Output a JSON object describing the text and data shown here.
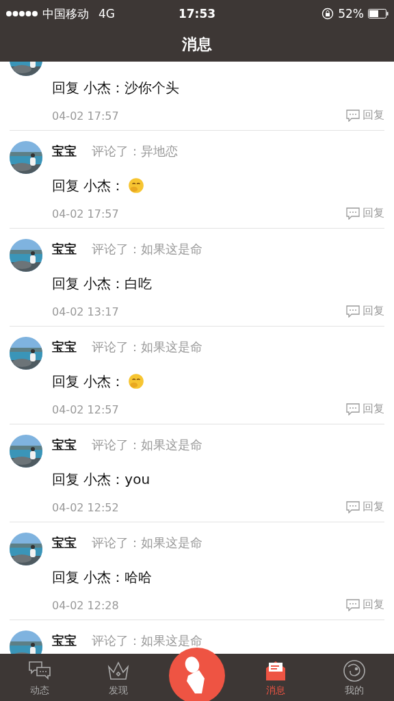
{
  "status_bar": {
    "carrier": "中国移动",
    "network": "4G",
    "time": "17:53",
    "battery": "52%"
  },
  "nav": {
    "title": "消息"
  },
  "messages": [
    {
      "reply": "回复 小杰：沙你个头",
      "sticker": false,
      "time": "04-02 17:57",
      "reply_button": "回复"
    },
    {
      "author": "宝宝",
      "action": "评论了：异地恋",
      "reply": "回复 小杰：",
      "sticker": true,
      "time": "04-02 17:57",
      "reply_button": "回复"
    },
    {
      "author": "宝宝",
      "action": "评论了：如果这是命",
      "reply": "回复 小杰：白吃",
      "sticker": false,
      "time": "04-02 13:17",
      "reply_button": "回复"
    },
    {
      "author": "宝宝",
      "action": "评论了：如果这是命",
      "reply": "回复 小杰：",
      "sticker": true,
      "time": "04-02 12:57",
      "reply_button": "回复"
    },
    {
      "author": "宝宝",
      "action": "评论了：如果这是命",
      "reply": "回复 小杰：you",
      "sticker": false,
      "time": "04-02 12:52",
      "reply_button": "回复"
    },
    {
      "author": "宝宝",
      "action": "评论了：如果这是命",
      "reply": "回复 小杰：哈哈",
      "sticker": false,
      "time": "04-02 12:28",
      "reply_button": "回复"
    },
    {
      "author": "宝宝",
      "action": "评论了：如果这是命"
    }
  ],
  "tab_bar": [
    {
      "kind": "chat",
      "label": "动态",
      "selected": false
    },
    {
      "kind": "crown",
      "label": "发现",
      "selected": false
    },
    {
      "kind": "mic"
    },
    {
      "kind": "mail",
      "label": "消息",
      "selected": true
    },
    {
      "kind": "planet",
      "label": "我的",
      "selected": false
    }
  ]
}
